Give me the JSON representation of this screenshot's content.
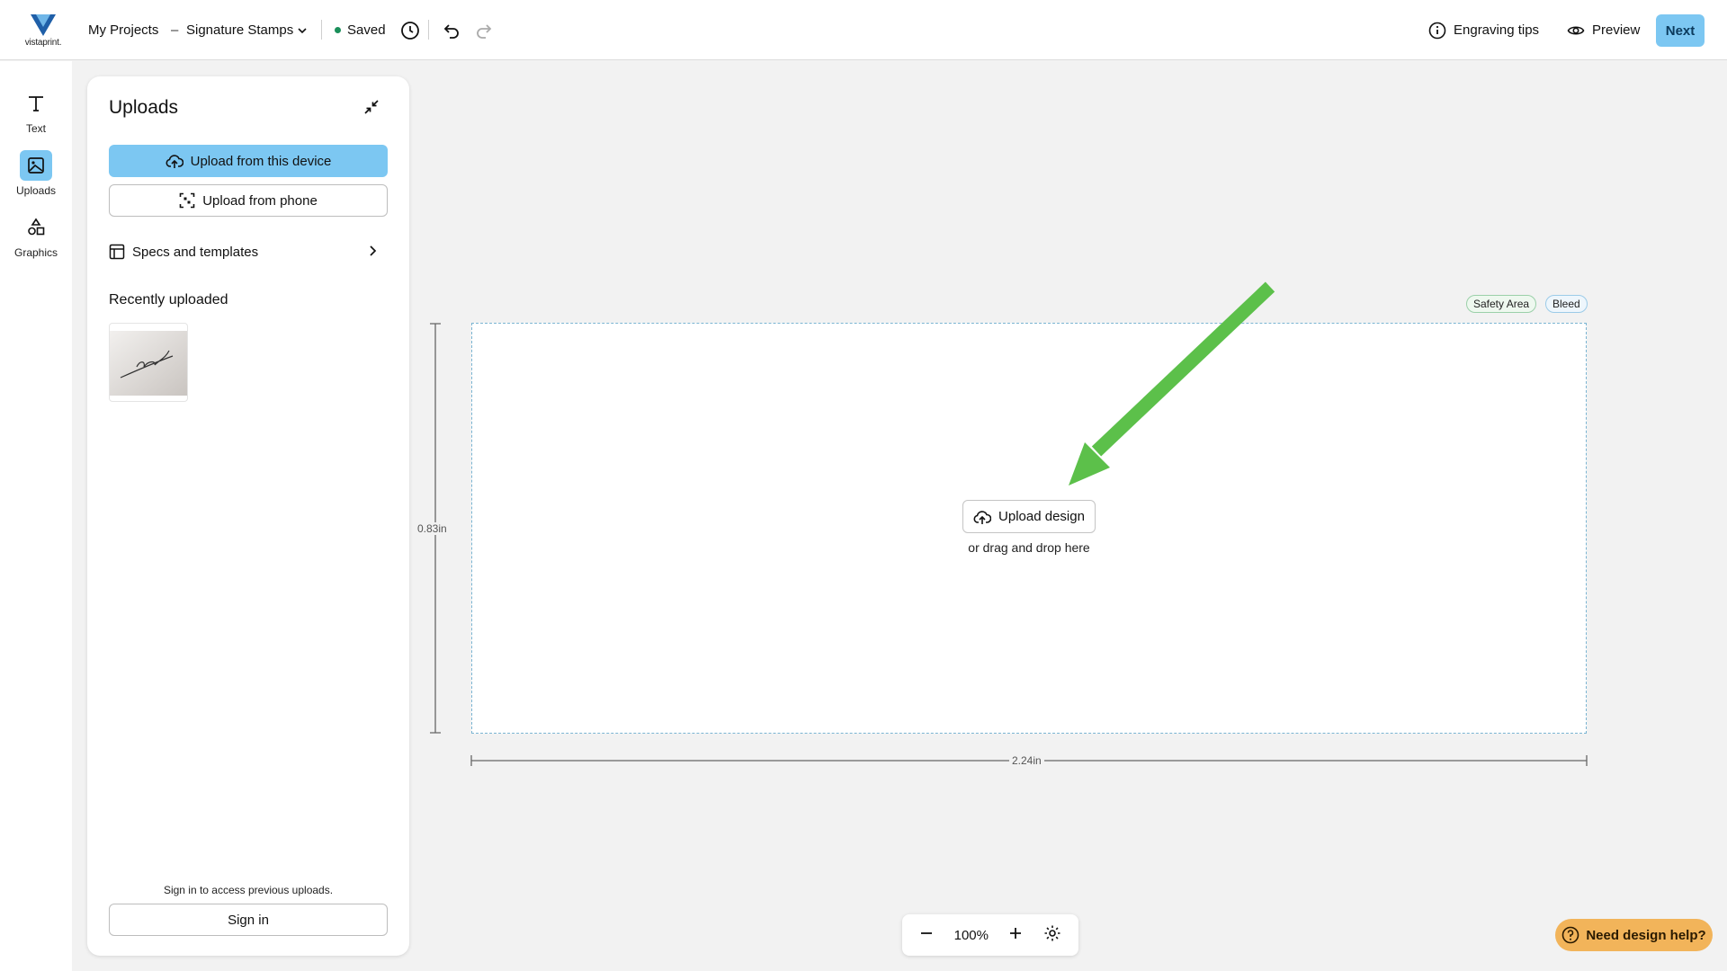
{
  "header": {
    "brand": "vistaprint.",
    "my_projects": "My Projects",
    "separator": "–",
    "project_title": "Signature Stamps",
    "saved_status": "Saved",
    "engraving_tips": "Engraving tips",
    "preview": "Preview",
    "next": "Next"
  },
  "rail": {
    "items": [
      {
        "label": "Text",
        "icon": "text-icon"
      },
      {
        "label": "Uploads",
        "icon": "image-upload-icon"
      },
      {
        "label": "Graphics",
        "icon": "shapes-icon"
      }
    ]
  },
  "panel": {
    "title": "Uploads",
    "upload_device": "Upload from this device",
    "upload_phone": "Upload from phone",
    "specs": "Specs and templates",
    "recently_uploaded": "Recently uploaded",
    "signin_hint": "Sign in to access previous uploads.",
    "signin_button": "Sign in"
  },
  "canvas": {
    "safety_area": "Safety Area",
    "bleed": "Bleed",
    "upload_design": "Upload design",
    "drag_hint": "or drag and drop here",
    "height_dim": "0.83in",
    "width_dim": "2.24in"
  },
  "zoom": {
    "level": "100%"
  },
  "help": {
    "label": "Need design help?"
  },
  "colors": {
    "accent": "#7cc7f2",
    "saved_dot": "#1a8f5a",
    "help": "#f2b45a",
    "arrow": "#5cc04a"
  }
}
